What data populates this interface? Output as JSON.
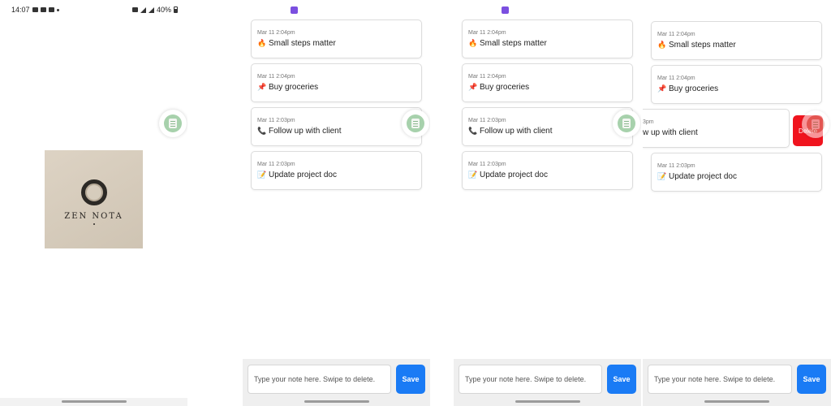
{
  "status_bar": {
    "time": "14:07",
    "battery": "40%"
  },
  "splash": {
    "logo_text": "ZEN NOTA"
  },
  "notes": [
    {
      "timestamp": "Mar 11 2:04pm",
      "emoji": "🔥",
      "text": "Small steps matter"
    },
    {
      "timestamp": "Mar 11 2:04pm",
      "emoji": "📌",
      "text": "Buy groceries"
    },
    {
      "timestamp": "Mar 11 2:03pm",
      "emoji": "📞",
      "text": "Follow up with client"
    },
    {
      "timestamp": "Mar 11 2:03pm",
      "emoji": "📝",
      "text": "Update project doc"
    }
  ],
  "swiped_note": {
    "timestamp": "3pm",
    "text": "w up with client"
  },
  "input": {
    "placeholder": "Type your note here. Swipe to delete.",
    "value": ""
  },
  "save_label": "Save",
  "delete_label": "Delete",
  "colors": {
    "save": "#1a7bf5",
    "delete": "#f0141e",
    "app_icon": "#7b4fe0",
    "bubble": "#a7d1ac"
  },
  "icons": {
    "bubble": "notes-bubble-icon",
    "app": "app-launcher-icon"
  }
}
